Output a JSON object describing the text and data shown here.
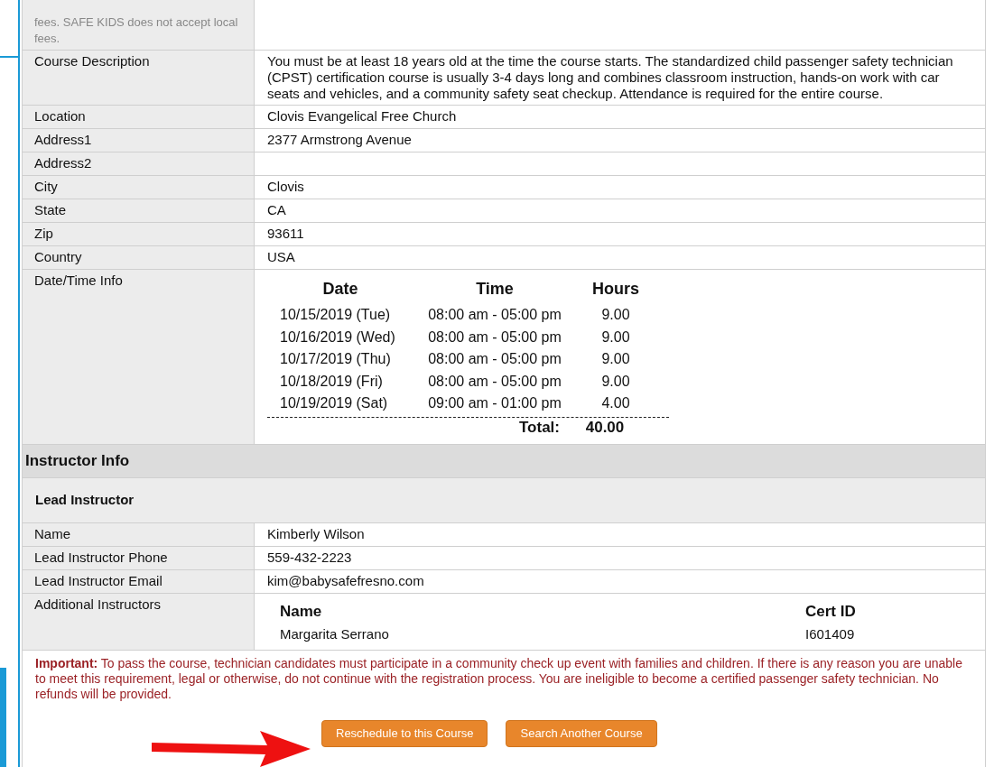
{
  "top_row": {
    "label": "fees. SAFE KIDS does not accept local fees."
  },
  "details": [
    {
      "label": "Course Description",
      "value": "You must be at least 18 years old at the time the course starts. The standardized child passenger safety technician (CPST) certification course is usually 3-4 days long and combines classroom instruction, hands-on work with car seats and vehicles, and a community safety seat checkup. Attendance is required for the entire course."
    },
    {
      "label": "Location",
      "value": "Clovis Evangelical Free Church"
    },
    {
      "label": "Address1",
      "value": "2377 Armstrong Avenue"
    },
    {
      "label": "Address2"
    },
    {
      "label": "City",
      "value": "Clovis"
    },
    {
      "label": "State",
      "value": "CA"
    },
    {
      "label": "Zip",
      "value": "93611"
    },
    {
      "label": "Country",
      "value": "USA"
    }
  ],
  "date_time": {
    "label": "Date/Time Info",
    "columns": [
      "Date",
      "Time",
      "Hours"
    ],
    "rows": [
      {
        "date": "10/15/2019 (Tue)",
        "time": "08:00 am - 05:00 pm",
        "hours": "9.00"
      },
      {
        "date": "10/16/2019 (Wed)",
        "time": "08:00 am - 05:00 pm",
        "hours": "9.00"
      },
      {
        "date": "10/17/2019 (Thu)",
        "time": "08:00 am - 05:00 pm",
        "hours": "9.00"
      },
      {
        "date": "10/18/2019 (Fri)",
        "time": "08:00 am - 05:00 pm",
        "hours": "9.00"
      },
      {
        "date": "10/19/2019 (Sat)",
        "time": "09:00 am - 01:00 pm",
        "hours": "4.00"
      }
    ],
    "total_label": "Total:",
    "total_value": "40.00"
  },
  "instructor_info": {
    "title": "Instructor Info",
    "lead_title": "Lead Instructor",
    "rows": [
      {
        "label": "Name",
        "value": "Kimberly Wilson"
      },
      {
        "label": "Lead Instructor Phone",
        "value": "559-432-2223"
      },
      {
        "label": "Lead Instructor Email",
        "value": "kim@babysafefresno.com"
      }
    ],
    "additional": {
      "label": "Additional Instructors",
      "columns": [
        "Name",
        "Cert ID"
      ],
      "rows": [
        {
          "name": "Margarita Serrano",
          "cert_id": "I601409"
        }
      ]
    }
  },
  "important": "**Important:** To pass the course, technician candidates must participate in a community check up event with families and children. If there is any reason you are unable to meet this requirement, legal or otherwise, do not continue with the registration process. You are ineligible to become a certified passenger safety technician. No refunds will be provided.",
  "buttons": [
    "Reschedule to this Course",
    "Search Another Course"
  ]
}
